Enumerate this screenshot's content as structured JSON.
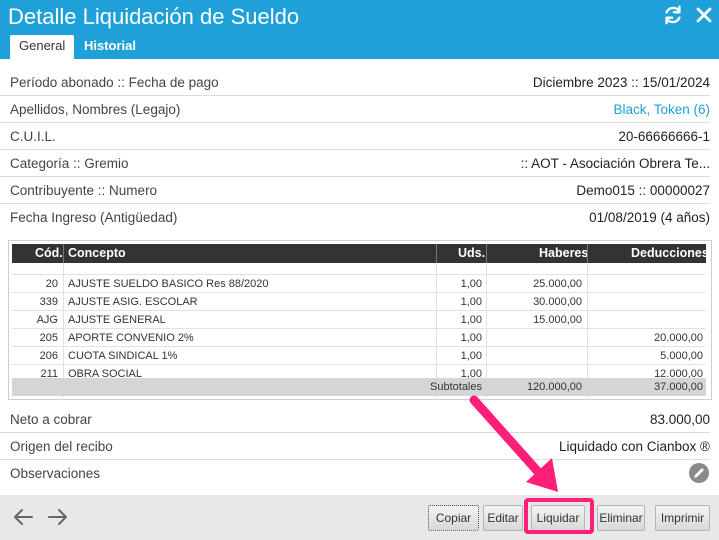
{
  "window": {
    "title": "Detalle Liquidación de Sueldo"
  },
  "tabs": [
    {
      "label": "General"
    },
    {
      "label": "Historial"
    }
  ],
  "info": [
    {
      "label": "Período abonado :: Fecha de pago",
      "value": "Diciembre 2023 :: 15/01/2024"
    },
    {
      "label": "Apellidos, Nombres (Legajo)",
      "value": "Black, Token (6)"
    },
    {
      "label": "C.U.I.L.",
      "value": "20-66666666-1"
    },
    {
      "label": "Categoría :: Gremio",
      "value": ":: AOT - Asociación Obrera Te..."
    },
    {
      "label": "Contribuyente :: Numero",
      "value": "Demo015 :: 00000027"
    },
    {
      "label": "Fecha Ingreso (Antigüedad)",
      "value": "01/08/2019 (4 años)"
    }
  ],
  "table": {
    "headers": {
      "cod": "Cód.",
      "concepto": "Concepto",
      "uds": "Uds.",
      "haberes": "Haberes",
      "deducciones": "Deducciones"
    },
    "rows": [
      {
        "cod": "20",
        "concepto": "AJUSTE SUELDO BASICO Res 88/2020",
        "uds": "1,00",
        "haberes": "25.000,00",
        "deducciones": ""
      },
      {
        "cod": "339",
        "concepto": "AJUSTE ASIG. ESCOLAR",
        "uds": "1,00",
        "haberes": "30.000,00",
        "deducciones": ""
      },
      {
        "cod": "AJG",
        "concepto": "AJUSTE GENERAL",
        "uds": "1,00",
        "haberes": "15.000,00",
        "deducciones": ""
      },
      {
        "cod": "205",
        "concepto": "APORTE CONVENIO 2%",
        "uds": "1,00",
        "haberes": "",
        "deducciones": "20.000,00"
      },
      {
        "cod": "206",
        "concepto": "CUOTA SINDICAL 1%",
        "uds": "1,00",
        "haberes": "",
        "deducciones": "5.000,00"
      },
      {
        "cod": "211",
        "concepto": "OBRA SOCIAL",
        "uds": "1,00",
        "haberes": "",
        "deducciones": "12.000,00"
      }
    ],
    "subtotals": {
      "label": "Subtotales",
      "haberes": "120.000,00",
      "deducciones": "37.000,00"
    }
  },
  "summary": [
    {
      "label": "Neto a cobrar",
      "value": "83.000,00"
    },
    {
      "label": "Origen del recibo",
      "value": "Liquidado con Cianbox ®"
    },
    {
      "label": "Observaciones",
      "value": ""
    }
  ],
  "buttons": {
    "copiar": "Copiar",
    "editar": "Editar",
    "liquidar": "Liquidar",
    "eliminar": "Eliminar",
    "imprimir": "Imprimir"
  },
  "colors": {
    "header": "#1fa0d8",
    "link": "#1fa0d8",
    "highlight": "#ff1f78",
    "table_header": "#333333"
  },
  "icons": {
    "refresh": "refresh-icon",
    "close": "close-icon",
    "back": "arrow-left-icon",
    "forward": "arrow-right-icon",
    "edit": "pencil-icon"
  }
}
